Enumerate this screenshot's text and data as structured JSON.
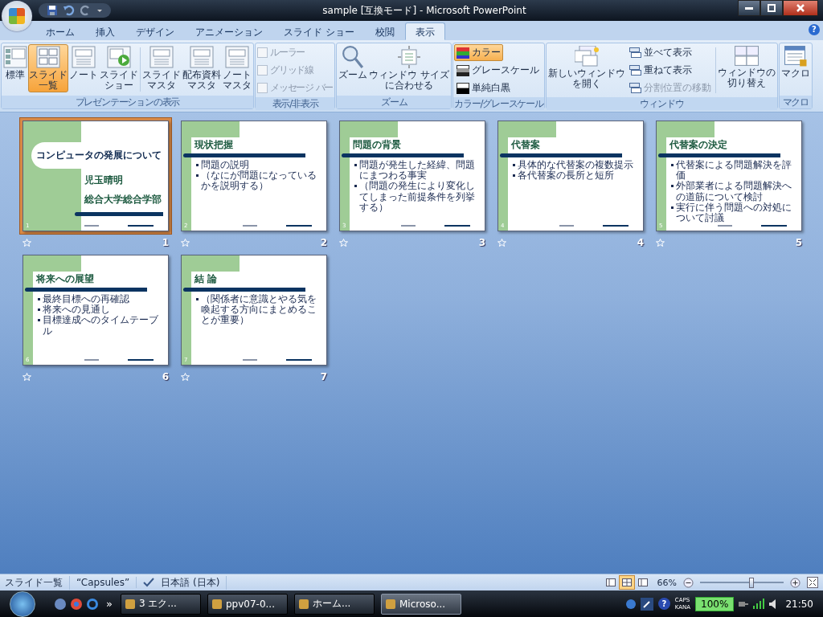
{
  "window": {
    "title": "sample [互換モード] - Microsoft PowerPoint"
  },
  "ribbon_tabs": [
    {
      "label": "ホーム",
      "selected": false
    },
    {
      "label": "挿入",
      "selected": false
    },
    {
      "label": "デザイン",
      "selected": false
    },
    {
      "label": "アニメーション",
      "selected": false
    },
    {
      "label": "スライド ショー",
      "selected": false
    },
    {
      "label": "校閲",
      "selected": false
    },
    {
      "label": "表示",
      "selected": true
    }
  ],
  "help": "?",
  "presentation_views": {
    "label": "プレゼンテーションの表示",
    "buttons": [
      {
        "lines": [
          "標準"
        ],
        "selected": false
      },
      {
        "lines": [
          "スライド",
          "一覧"
        ],
        "selected": true
      },
      {
        "lines": [
          "ノート"
        ],
        "selected": false
      },
      {
        "lines": [
          "スライド",
          "ショー"
        ],
        "selected": false
      },
      {
        "lines": [
          "スライド",
          "マスタ"
        ],
        "selected": false
      },
      {
        "lines": [
          "配布資料",
          "マスタ"
        ],
        "selected": false
      },
      {
        "lines": [
          "ノート",
          "マスタ"
        ],
        "selected": false
      }
    ]
  },
  "show_hide": {
    "label": "表示/非表示",
    "items": [
      {
        "label": "ルーラー",
        "checked": false,
        "disabled": true
      },
      {
        "label": "グリッド線",
        "checked": false,
        "disabled": true
      },
      {
        "label": "メッセージ バー",
        "checked": false,
        "disabled": true
      }
    ]
  },
  "zoom": {
    "label": "ズーム",
    "buttons": [
      {
        "lines": [
          "ズーム"
        ]
      },
      {
        "lines": [
          "ウィンドウ サイズ",
          "に合わせる"
        ]
      }
    ]
  },
  "color_mode": {
    "label": "カラー/グレースケール",
    "items": [
      {
        "label": "カラー",
        "selected": true
      },
      {
        "label": "グレースケール",
        "selected": false
      },
      {
        "label": "単純白黒",
        "selected": false
      }
    ]
  },
  "window_group": {
    "label": "ウィンドウ",
    "new_window": [
      "新しいウィンドウ",
      "を開く"
    ],
    "items": [
      {
        "label": "並べて表示",
        "disabled": false
      },
      {
        "label": "重ねて表示",
        "disabled": false
      },
      {
        "label": "分割位置の移動",
        "disabled": true
      }
    ],
    "switch": [
      "ウィンドウの",
      "切り替え"
    ]
  },
  "macro": {
    "label": "マクロ",
    "button": "マクロ"
  },
  "slides": [
    {
      "kind": "title",
      "selected": true,
      "slide_number": "1",
      "caption": "1",
      "title": "コンピュータの発展について",
      "lines": [
        "児玉晴明",
        "総合大学総合学部"
      ]
    },
    {
      "kind": "content",
      "selected": false,
      "slide_number": "2",
      "caption": "2",
      "title": "現状把握",
      "lines": [
        "問題の説明",
        "（なにが問題になっているかを説明する）"
      ]
    },
    {
      "kind": "content",
      "selected": false,
      "slide_number": "3",
      "caption": "3",
      "title": "問題の背景",
      "lines": [
        "問題が発生した経緯、問題にまつわる事実",
        "（問題の発生により変化してしまった前提条件を列挙する）"
      ]
    },
    {
      "kind": "content",
      "selected": false,
      "slide_number": "4",
      "caption": "4",
      "title": "代替案",
      "lines": [
        "具体的な代替案の複数提示",
        "各代替案の長所と短所"
      ]
    },
    {
      "kind": "content",
      "selected": false,
      "slide_number": "5",
      "caption": "5",
      "title": "代替案の決定",
      "lines": [
        "代替案による問題解決を評価",
        "外部業者による問題解決への道筋について検討",
        "実行に伴う問題への対処について討議"
      ]
    },
    {
      "kind": "content",
      "selected": false,
      "slide_number": "6",
      "caption": "6",
      "title": "将来への展望",
      "lines": [
        "最終目標への再確認",
        "将来への見通し",
        "目標達成へのタイムテーブル"
      ]
    },
    {
      "kind": "content",
      "selected": false,
      "slide_number": "7",
      "caption": "7",
      "title": "結 論",
      "lines": [
        "（関係者に意識とやる気を喚起する方向にまとめることが重要）"
      ]
    }
  ],
  "status_bar": {
    "view": "スライド一覧",
    "theme": "“Capsules”",
    "language": "日本語 (日本)",
    "views": [
      {
        "selected": false
      },
      {
        "selected": true
      },
      {
        "selected": false
      }
    ],
    "zoom": "66%",
    "level": 0.62
  },
  "taskbar": {
    "chevron": "»",
    "tasks": [
      {
        "label": "3 エク...",
        "selected": false
      },
      {
        "label": "ppv07-0...",
        "selected": false
      },
      {
        "label": "ホーム...",
        "selected": false
      },
      {
        "label": "Microso...",
        "selected": true
      }
    ],
    "help": "?",
    "caps": "CAPS",
    "kana": "KANA",
    "battery": "100%",
    "time": "21:50"
  }
}
